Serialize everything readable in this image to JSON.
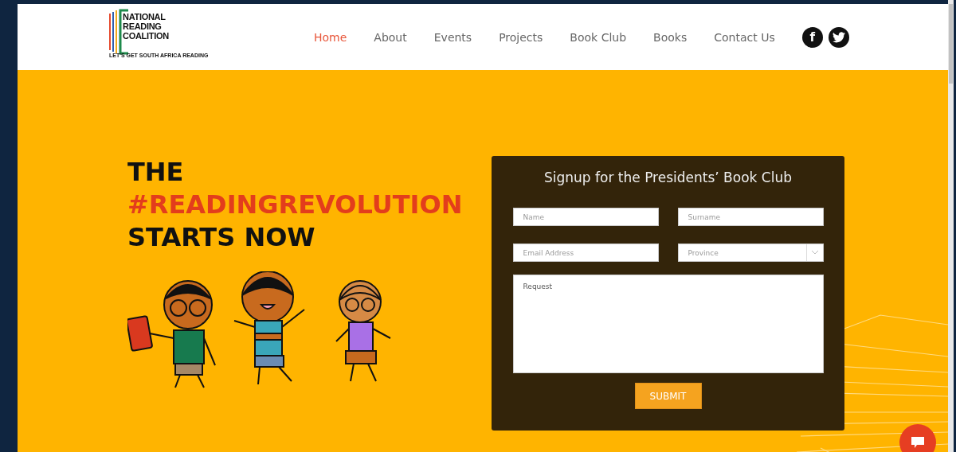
{
  "logo": {
    "lines": [
      "NATIONAL",
      "READING",
      "COALITION"
    ],
    "tagline": "LET'S GET SOUTH AFRICA READING"
  },
  "nav": [
    {
      "label": "Home",
      "selected": true
    },
    {
      "label": "About",
      "selected": false
    },
    {
      "label": "Events",
      "selected": false
    },
    {
      "label": "Projects",
      "selected": false
    },
    {
      "label": "Book Club",
      "selected": false
    },
    {
      "label": "Books",
      "selected": false
    },
    {
      "label": "Contact Us",
      "selected": false
    }
  ],
  "social": [
    {
      "kind": "facebook",
      "glyph": "f"
    },
    {
      "kind": "twitter"
    }
  ],
  "hero": {
    "heading": [
      {
        "text": "THE",
        "kind": "plain"
      },
      {
        "text": "#READINGREVOLUTION",
        "kind": "accent"
      },
      {
        "text": "STARTS NOW",
        "kind": "plain"
      }
    ]
  },
  "form": {
    "title": "Signup for the Presidents’ Book Club",
    "fields": [
      {
        "kind": "text",
        "placeholder": "Name"
      },
      {
        "kind": "text",
        "placeholder": "Surname"
      },
      {
        "kind": "text",
        "placeholder": "Email Address"
      },
      {
        "kind": "select",
        "placeholder": "Province"
      },
      {
        "kind": "textarea",
        "placeholder": "Request"
      }
    ],
    "submit": "SUBMIT"
  }
}
